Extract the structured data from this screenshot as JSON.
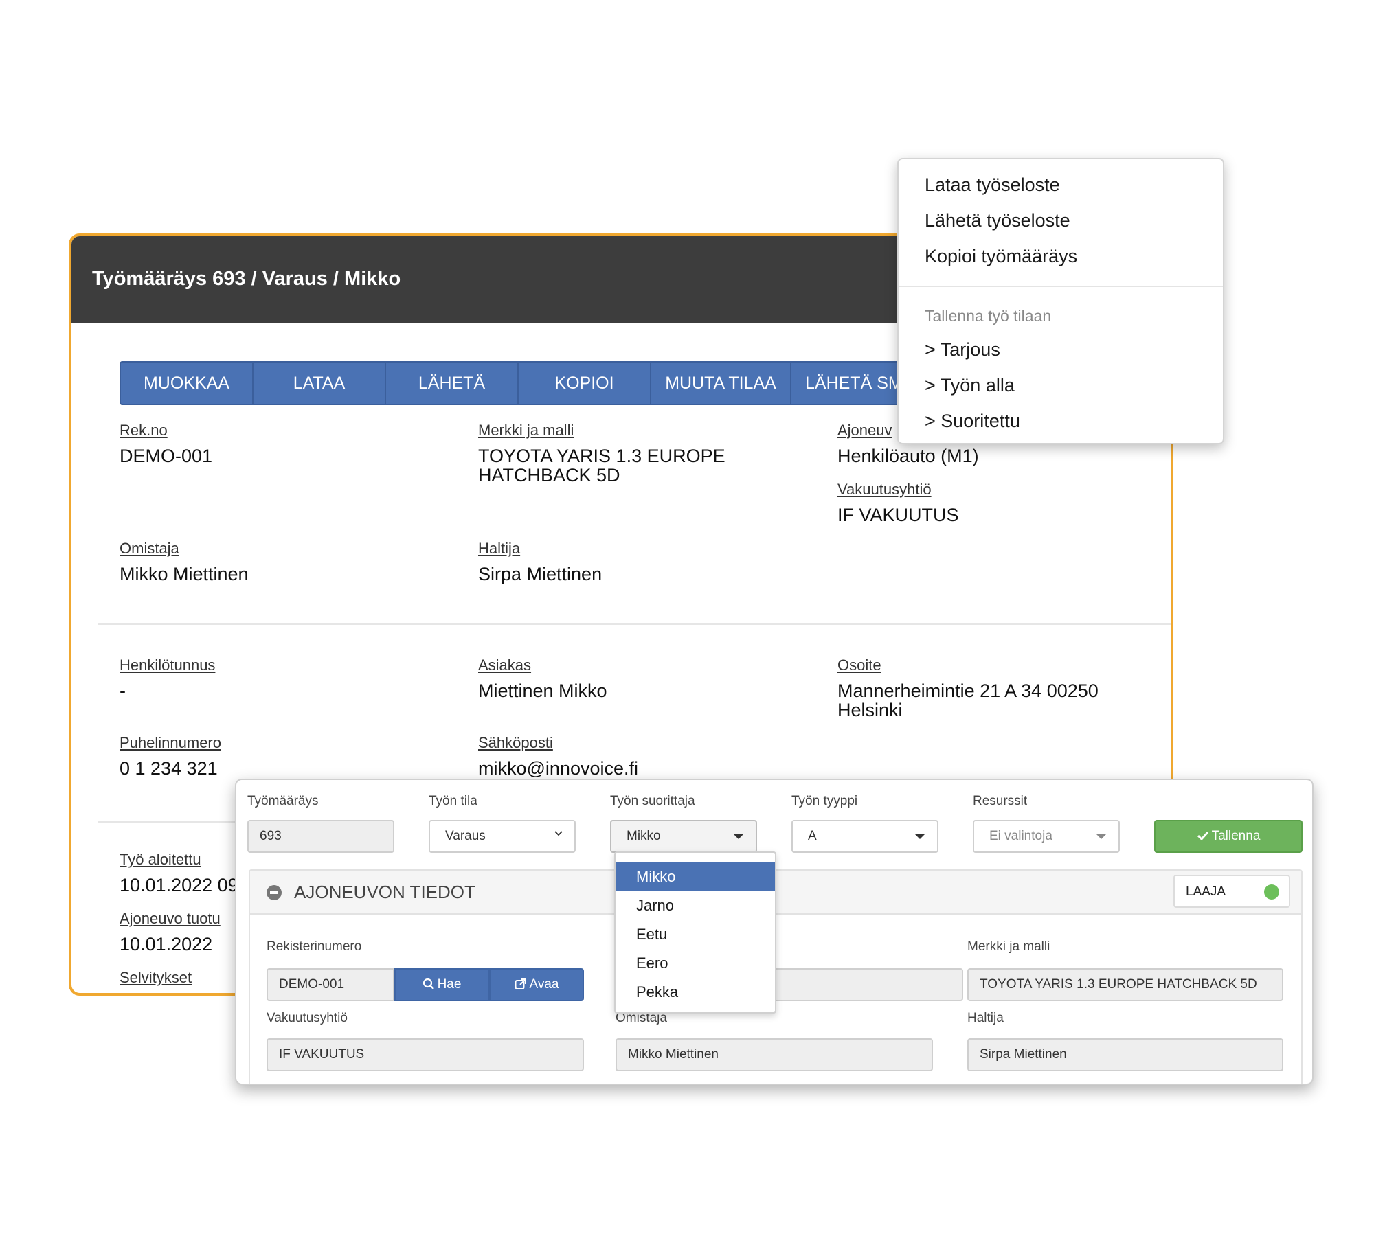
{
  "header": {
    "title": "Työmääräys 693 / Varaus / Mikko"
  },
  "toolbar": [
    "MUOKKAA",
    "LATAA",
    "LÄHETÄ",
    "KOPIOI",
    "MUUTA TILAA",
    "LÄHETÄ SM"
  ],
  "vehicle": {
    "rekno_label": "Rek.no",
    "rekno": "DEMO-001",
    "model_label": "Merkki ja malli",
    "model_line1": "TOYOTA YARIS 1.3 EUROPE",
    "model_line2": "HATCHBACK 5D",
    "type_label": "Ajoneuv",
    "type": "Henkilöauto (M1)",
    "insurance_label": "Vakuutusyhtiö",
    "insurance": "IF VAKUUTUS",
    "owner_label": "Omistaja",
    "owner": "Mikko Miettinen",
    "holder_label": "Haltija",
    "holder": "Sirpa Miettinen"
  },
  "customer": {
    "ssn_label": "Henkilötunnus",
    "ssn": "-",
    "name_label": "Asiakas",
    "name": "Miettinen Mikko",
    "address_label": "Osoite",
    "address_line1": "Mannerheimintie 21 A 34 00250",
    "address_line2": "Helsinki",
    "phone_label": "Puhelinnumero",
    "phone": "0 1 234 321",
    "email_label": "Sähköposti",
    "email": "mikko@innovoice.fi"
  },
  "work": {
    "started_label": "Työ aloitettu",
    "started": "10.01.2022 09",
    "arrived_label": "Ajoneuvo tuotu",
    "arrived": "10.01.2022",
    "notes_label": "Selvitykset"
  },
  "action_menu": {
    "items": [
      "Lataa työseloste",
      "Lähetä työseloste",
      "Kopioi työmääräys"
    ],
    "status_header": "Tallenna työ tilaan",
    "status_items": [
      "> Tarjous",
      "> Työn alla",
      "> Suoritettu"
    ]
  },
  "form": {
    "order_label": "Työmääräys",
    "order_value": "693",
    "status_label": "Työn tila",
    "status_value": "Varaus",
    "performer_label": "Työn suorittaja",
    "performer_value": "Mikko",
    "type_label": "Työn tyyppi",
    "type_value": "A",
    "resources_label": "Resurssit",
    "resources_value": "Ei valintoja",
    "save_label": "Tallenna",
    "section_title": "AJONEUVON TIEDOT",
    "toggle_label": "LAAJA",
    "reg_label": "Rekisterinumero",
    "reg_value": "DEMO-001",
    "search_label": "Hae",
    "open_label": "Avaa",
    "model_label": "Merkki ja malli",
    "model_value": "TOYOTA YARIS 1.3 EUROPE HATCHBACK 5D",
    "insurance_label": "Vakuutusyhtiö",
    "insurance_value": "IF VAKUUTUS",
    "owner_label": "Omistaja",
    "owner_value": "Mikko Miettinen",
    "holder_label": "Haltija",
    "holder_value": "Sirpa Miettinen"
  },
  "performer_dropdown": {
    "options": [
      "Mikko",
      "Jarno",
      "Eetu",
      "Eero",
      "Pekka"
    ],
    "selected": "Mikko"
  },
  "colors": {
    "accent_blue": "#4a72b4",
    "border_orange": "#f0a830",
    "header_dark": "#3d3d3d",
    "save_green": "#6db35c"
  },
  "icons": {
    "search": "search-icon",
    "open": "external-link-icon",
    "check": "check-icon",
    "collapse": "minus-circle-icon"
  }
}
